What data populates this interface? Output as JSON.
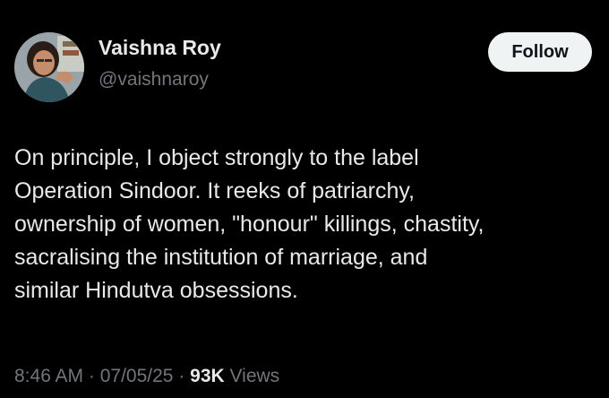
{
  "author": {
    "name": "Vaishna Roy",
    "handle": "@vaishnaroy",
    "avatar_icon": "user-avatar-photo"
  },
  "actions": {
    "follow_label": "Follow"
  },
  "tweet": {
    "text": "On principle, I object strongly to the label\nOperation Sindoor. It reeks of patriarchy,\nownership of women, \"honour\" killings, chastity,\nsacralising the institution of marriage, and\nsimilar Hindutva obsessions."
  },
  "meta": {
    "time": "8:46 AM",
    "separator": " · ",
    "date": "07/05/25",
    "views_count": "93K",
    "views_label": " Views"
  },
  "colors": {
    "background": "#000000",
    "primary_text": "#e7e9ea",
    "secondary_text": "#71767b",
    "follow_bg": "#eff3f4",
    "follow_text": "#0f1419"
  }
}
